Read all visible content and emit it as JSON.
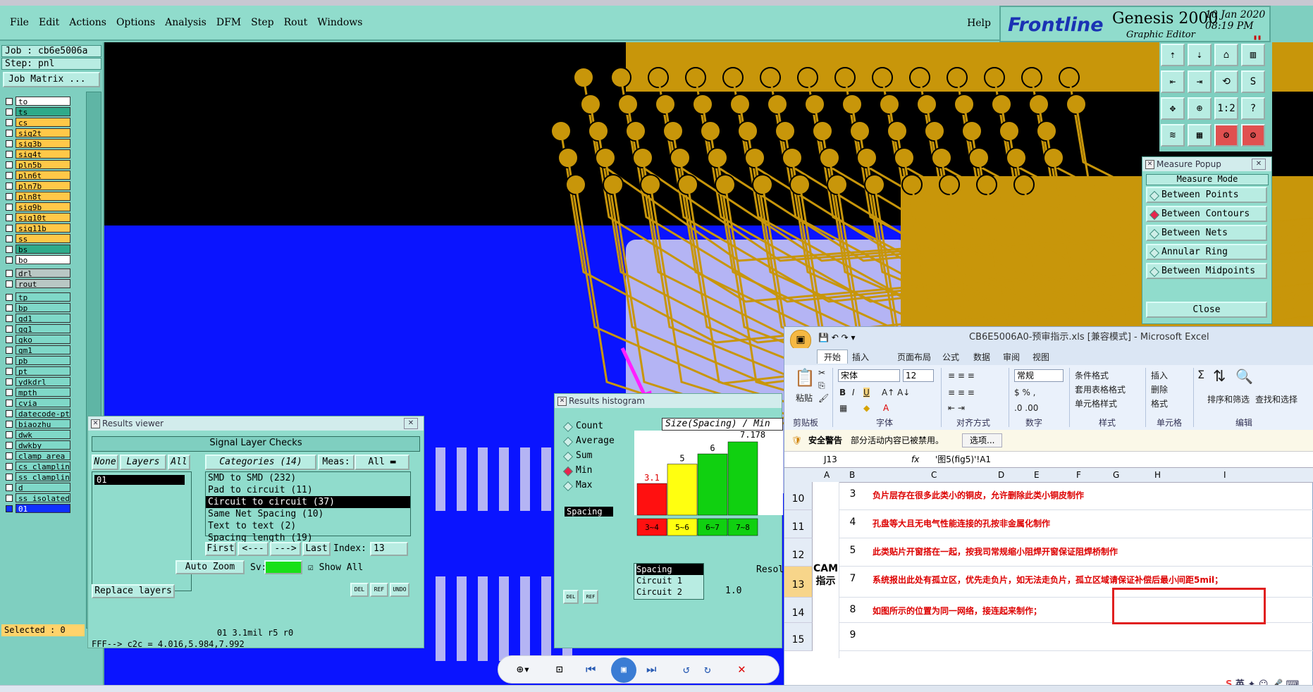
{
  "menu": {
    "items": [
      "File",
      "Edit",
      "Actions",
      "Options",
      "Analysis",
      "DFM",
      "Step",
      "Rout",
      "Windows"
    ],
    "help": "Help"
  },
  "brand": {
    "logo": "Frontline",
    "product": "Genesis 2000",
    "subtitle": "Graphic Editor",
    "date": "10 Jan 2020",
    "time": "08:19 PM",
    "marker": "▮▮"
  },
  "job": {
    "job": "Job : cb6e5006a",
    "step": "Step: pnl",
    "matrix_btn": "Job Matrix ..."
  },
  "layers": {
    "group1": [
      {
        "name": "to",
        "color": "#ffffff"
      },
      {
        "name": "ts",
        "color": "#2faa8a"
      },
      {
        "name": "cs",
        "color": "#ffc848"
      },
      {
        "name": "sig2t",
        "color": "#ffc848"
      },
      {
        "name": "sig3b",
        "color": "#ffc848"
      },
      {
        "name": "sig4t",
        "color": "#ffc848"
      },
      {
        "name": "pln5b",
        "color": "#ffc848"
      },
      {
        "name": "pln6t",
        "color": "#ffc848"
      },
      {
        "name": "pln7b",
        "color": "#ffc848"
      },
      {
        "name": "pln8t",
        "color": "#ffc848"
      },
      {
        "name": "sig9b",
        "color": "#ffc848"
      },
      {
        "name": "sig10t",
        "color": "#ffc848"
      },
      {
        "name": "sig11b",
        "color": "#ffc848"
      },
      {
        "name": "ss",
        "color": "#ffc848"
      },
      {
        "name": "bs",
        "color": "#2faa8a"
      },
      {
        "name": "bo",
        "color": "#ffffff"
      }
    ],
    "group2": [
      {
        "name": "drl",
        "color": "#b9c7c4"
      },
      {
        "name": "rout",
        "color": "#b9c7c4"
      }
    ],
    "group3": [
      {
        "name": "tp"
      },
      {
        "name": "bp"
      },
      {
        "name": "gd1"
      },
      {
        "name": "gg1"
      },
      {
        "name": "gko"
      },
      {
        "name": "gm1"
      },
      {
        "name": "pb"
      },
      {
        "name": "pt"
      },
      {
        "name": "ydkdrl"
      },
      {
        "name": "mpth"
      },
      {
        "name": "cvia"
      },
      {
        "name": "datecode-pt"
      },
      {
        "name": "biaozhu"
      },
      {
        "name": "dwk"
      },
      {
        "name": "dwkby"
      },
      {
        "name": "clamp_area"
      },
      {
        "name": "cs_clampline"
      },
      {
        "name": "ss_clampline"
      },
      {
        "name": "d"
      },
      {
        "name": "ss_isolated"
      },
      {
        "name": "01"
      }
    ],
    "selected": "Selected : 0"
  },
  "tools": [
    "⇡",
    "⇣",
    "⌂",
    "▥",
    "⇤",
    "⇥",
    "⟲",
    "S",
    "✥",
    "⊕",
    "1:2",
    "?",
    "≋",
    "▦",
    "⚙",
    "⚙"
  ],
  "measure": {
    "title": "Measure Popup",
    "mode_label": "Measure Mode",
    "options": [
      "Between Points",
      "Between Contours",
      "Between Nets",
      "Annular Ring",
      "Between Midpoints"
    ],
    "active_index": 1,
    "close": "Close"
  },
  "results_viewer": {
    "title": "Results viewer",
    "header": "Signal Layer Checks",
    "btn_none": "None",
    "btn_layers": "Layers",
    "btn_all": "All",
    "categories_label": "Categories (14)",
    "meas_label": "Meas:",
    "meas_value": "All",
    "layer_item": "01",
    "categories": [
      "SMD to SMD (232)",
      "Pad to circuit (11)",
      "Circuit to circuit (37)",
      "Same Net Spacing (10)",
      "Text to text (2)",
      "Spacing length (19)"
    ],
    "selected_category": 2,
    "btn_first": "First",
    "btn_prev": "<---",
    "btn_next": "--->",
    "btn_last": "Last",
    "index_label": "Index:",
    "index_value": "13",
    "auto_zoom": "Auto Zoom",
    "sv_label": "Sv:",
    "show_all": "Show All",
    "replace_layers": "Replace layers",
    "btn_del": "DEL",
    "btn_ref": "REF",
    "btn_undo": "UNDO",
    "status": "01 3.1mil  r5  r0",
    "bottom": "FFF--> c2c = 4.016,5.984,7.992"
  },
  "histogram": {
    "title": "Results histogram",
    "options": [
      "Count",
      "Average",
      "Sum",
      "Min",
      "Max"
    ],
    "active_index": 3,
    "spacing": "Spacing",
    "chart_title": "Size(Spacing) / Min",
    "max_label": "7.178",
    "bars": [
      {
        "label": "3.1",
        "range": "3~4",
        "color": "#ff1010",
        "value": 3.1
      },
      {
        "label": "5",
        "range": "5~6",
        "color": "#ffff10",
        "value": 5
      },
      {
        "label": "6",
        "range": "6~7",
        "color": "#10d010",
        "value": 6
      },
      {
        "label": "",
        "range": "7~8",
        "color": "#10d010",
        "value": 7.178
      }
    ],
    "legend": [
      "Spacing",
      "Circuit 1",
      "Circuit 2"
    ],
    "reso_label": "Resol",
    "reso_value": "1.0",
    "btn_del": "DEL",
    "btn_ref": "REF"
  },
  "excel": {
    "title": "CB6E5006A0-预审指示.xls  [兼容模式] - Microsoft Excel",
    "tabs": [
      "开始",
      "插入",
      "页面布局",
      "公式",
      "数据",
      "审阅",
      "视图"
    ],
    "ribbon": {
      "paste": "粘贴",
      "font_name": "宋体",
      "font_size": "12",
      "num_format": "常规",
      "cond_format": "条件格式",
      "table_format": "套用表格格式",
      "cell_style": "单元格样式",
      "insert": "插入",
      "delete": "删除",
      "format": "格式",
      "sort": "排序和筛选",
      "find": "查找和选择",
      "groups": [
        "剪贴板",
        "字体",
        "对齐方式",
        "数字",
        "样式",
        "单元格",
        "编辑"
      ]
    },
    "warning": {
      "label": "安全警告",
      "text": "部分活动内容已被禁用。",
      "button": "选项..."
    },
    "namebox": "J13",
    "formula": "'图5(fig5)'!A1",
    "columns": [
      "A",
      "B",
      "C",
      "D",
      "E",
      "F",
      "G",
      "H",
      "I"
    ],
    "rows": [
      {
        "row": "10",
        "num": "3",
        "text": "负片层存在很多此类小的铜皮，允许删除此类小铜皮制作"
      },
      {
        "row": "11",
        "num": "4",
        "text": "孔盘等大且无电气性能连接的孔按非金属化制作"
      },
      {
        "row": "12",
        "num": "5",
        "text": "此类贴片开窗搭在一起，按我司常规缩小阻焊开窗保证阻焊桥制作"
      },
      {
        "row": "13",
        "num": "7",
        "text": "系统报出此处有孤立区，优先走负片，如无法走负片，孤立区域请保证补偿后最小间距5mil；"
      },
      {
        "row": "14",
        "num": "8",
        "text": "如图所示的位置为同一网络，接连起来制作；"
      },
      {
        "row": "15",
        "num": "9",
        "text": ""
      }
    ],
    "cam_label": "CAM 指示",
    "ime": "英"
  },
  "colors": {
    "teal": "#90dccc",
    "copper": "#c8960a",
    "blue": "#0a14ff",
    "lavender": "#b4b4f4"
  }
}
